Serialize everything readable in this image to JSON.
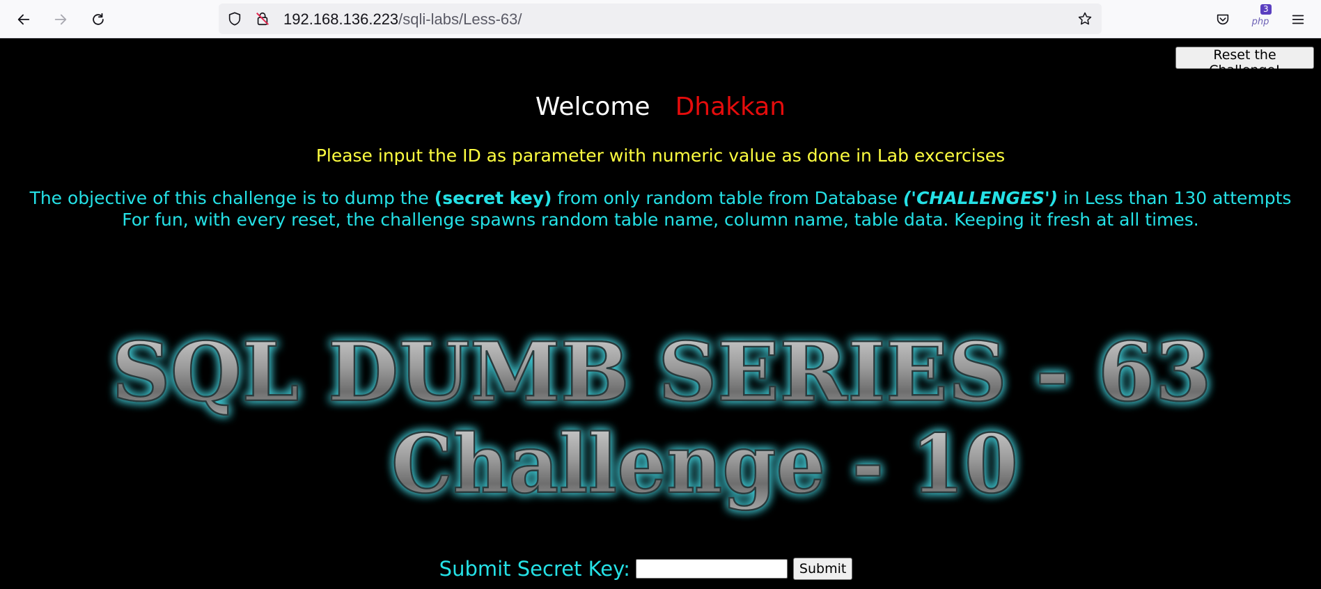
{
  "browser": {
    "url_host": "192.168.136.223",
    "url_path": "/sqli-labs/Less-63/",
    "extension_badge": "3",
    "extension_label": "php",
    "icons": [
      "back-icon",
      "forward-icon",
      "reload-icon",
      "shield-icon",
      "insecure-lock-icon",
      "bookmark-star-icon",
      "pocket-icon",
      "php-extension-icon",
      "menu-icon"
    ]
  },
  "page": {
    "reset_label": "Reset the Challenge!",
    "welcome_label": "Welcome",
    "welcome_name": "Dhakkan",
    "instruction": "Please input the ID as parameter with numeric value as done in Lab excercises",
    "objective": {
      "part1": "The objective of this challenge is to dump the ",
      "secret_key": "(secret key)",
      "part2": " from only random table from Database ",
      "database": "('CHALLENGES')",
      "part3": " in Less than 130 attempts"
    },
    "objective_line2": "For fun, with every reset, the challenge spawns random table name, column name, table data. Keeping it fresh at all times.",
    "banner_line1": "SQL DUMB SERIES - 63",
    "banner_line2": "Challenge - 10",
    "submit_label": "Submit Secret Key:",
    "secret_value": "",
    "submit_button": "Submit"
  },
  "colors": {
    "welcome_name": "#e50c0c",
    "instruction": "#ffff40",
    "objective": "#25e1e6",
    "background": "#000000"
  }
}
